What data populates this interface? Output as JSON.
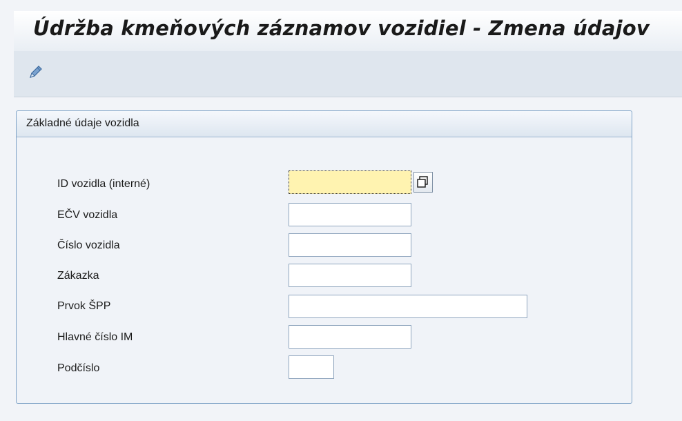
{
  "header": {
    "title": "Údržba kmeňových záznamov vozidiel - Zmena údajov"
  },
  "toolbar": {
    "items": [
      {
        "icon": "pencil-icon"
      }
    ]
  },
  "group": {
    "title": "Základné údaje vozidla",
    "fields": [
      {
        "label": "ID vozidla (interné)",
        "value": ""
      },
      {
        "label": "EČV vozidla",
        "value": ""
      },
      {
        "label": "Číslo vozidla",
        "value": ""
      },
      {
        "label": "Zákazka",
        "value": ""
      },
      {
        "label": "Prvok ŠPP",
        "value": ""
      },
      {
        "label": "Hlavné číslo IM",
        "value": ""
      },
      {
        "label": "Podčíslo",
        "value": ""
      }
    ]
  },
  "colors": {
    "focused_field": "#fff3b0",
    "group_border": "#7fa3c7",
    "toolbar_bg": "#dfe6ee"
  }
}
